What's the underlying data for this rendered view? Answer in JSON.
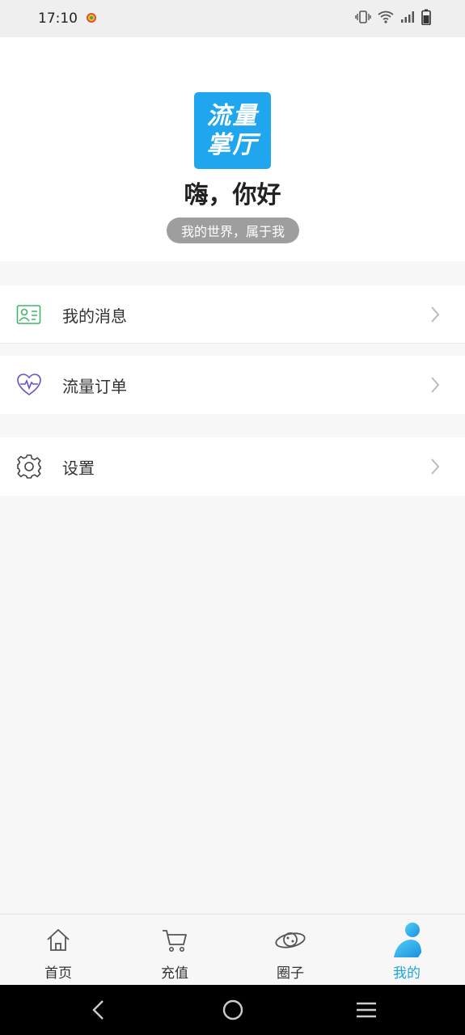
{
  "status_bar": {
    "time": "17:10"
  },
  "header": {
    "logo_line1": "流量",
    "logo_line2": "掌厅",
    "greeting": "嗨，你好",
    "tagline": "我的世界，属于我"
  },
  "menu": {
    "messages": {
      "label": "我的消息",
      "icon": "contact-card-icon"
    },
    "orders": {
      "label": "流量订单",
      "icon": "heart-pulse-icon"
    },
    "settings": {
      "label": "设置",
      "icon": "gear-icon"
    }
  },
  "tabs": [
    {
      "label": "首页",
      "icon": "home-icon"
    },
    {
      "label": "充值",
      "icon": "cart-icon"
    },
    {
      "label": "圈子",
      "icon": "planet-icon"
    },
    {
      "label": "我的",
      "icon": "user-icon",
      "active": true
    }
  ],
  "colors": {
    "accent": "#1fa6d6",
    "logo_bg": "#1fa6ee",
    "message_icon": "#3fb56a",
    "order_icon": "#6a4fc7"
  }
}
